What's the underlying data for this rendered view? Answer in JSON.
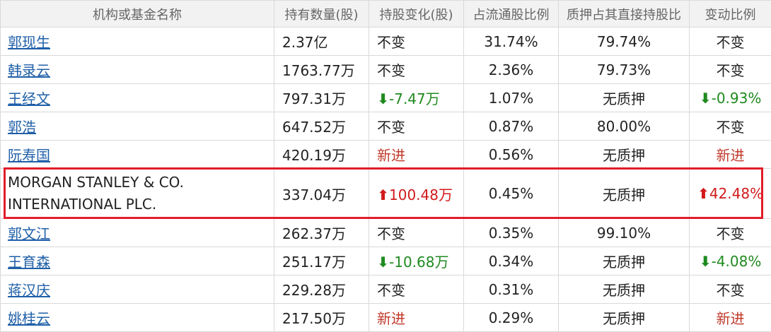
{
  "headers": [
    "机构或基金名称",
    "持有数量(股)",
    "持股变化(股)",
    "占流通股比例",
    "质押占其直接持股比",
    "变动比例"
  ],
  "rows": [
    {
      "name": "郭现生",
      "link": true,
      "qty": "2.37亿",
      "change": "不变",
      "change_dir": "none",
      "ratio": "31.74%",
      "pledge": "79.74%",
      "vratio": "不变",
      "vratio_dir": "none"
    },
    {
      "name": "韩录云",
      "link": true,
      "qty": "1763.77万",
      "change": "不变",
      "change_dir": "none",
      "ratio": "2.36%",
      "pledge": "79.73%",
      "vratio": "不变",
      "vratio_dir": "none"
    },
    {
      "name": "王经文",
      "link": true,
      "qty": "797.31万",
      "change": "-7.47万",
      "change_dir": "down",
      "ratio": "1.07%",
      "pledge": "无质押",
      "vratio": "-0.93%",
      "vratio_dir": "down"
    },
    {
      "name": "郭浩",
      "link": true,
      "qty": "647.52万",
      "change": "不变",
      "change_dir": "none",
      "ratio": "0.87%",
      "pledge": "80.00%",
      "vratio": "不变",
      "vratio_dir": "none"
    },
    {
      "name": "阮寿国",
      "link": true,
      "qty": "420.19万",
      "change": "新进",
      "change_dir": "new",
      "ratio": "0.56%",
      "pledge": "无质押",
      "vratio": "新进",
      "vratio_dir": "new"
    },
    {
      "name": "MORGAN STANLEY & CO. INTERNATIONAL PLC.",
      "link": false,
      "qty": "337.04万",
      "change": "100.48万",
      "change_dir": "up",
      "ratio": "0.45%",
      "pledge": "无质押",
      "vratio": "42.48%",
      "vratio_dir": "up",
      "highlighted": true
    },
    {
      "name": "郭文江",
      "link": true,
      "qty": "262.37万",
      "change": "不变",
      "change_dir": "none",
      "ratio": "0.35%",
      "pledge": "99.10%",
      "vratio": "不变",
      "vratio_dir": "none"
    },
    {
      "name": "王育森",
      "link": true,
      "qty": "251.17万",
      "change": "-10.68万",
      "change_dir": "down",
      "ratio": "0.34%",
      "pledge": "无质押",
      "vratio": "-4.08%",
      "vratio_dir": "down"
    },
    {
      "name": "蒋汉庆",
      "link": true,
      "qty": "229.28万",
      "change": "不变",
      "change_dir": "none",
      "ratio": "0.31%",
      "pledge": "无质押",
      "vratio": "不变",
      "vratio_dir": "none"
    },
    {
      "name": "姚桂云",
      "link": true,
      "qty": "217.50万",
      "change": "新进",
      "change_dir": "new",
      "ratio": "0.29%",
      "pledge": "无质押",
      "vratio": "新进",
      "vratio_dir": "new"
    }
  ],
  "icons": {
    "up": "up-arrow-icon",
    "down": "down-arrow-icon"
  },
  "colors": {
    "link": "#1f5fa8",
    "up": "#d11a1a",
    "down": "#1f8a1f",
    "new": "#c0392b",
    "highlight_border": "#e11d2a",
    "header_bg": "#f2f2f2"
  }
}
